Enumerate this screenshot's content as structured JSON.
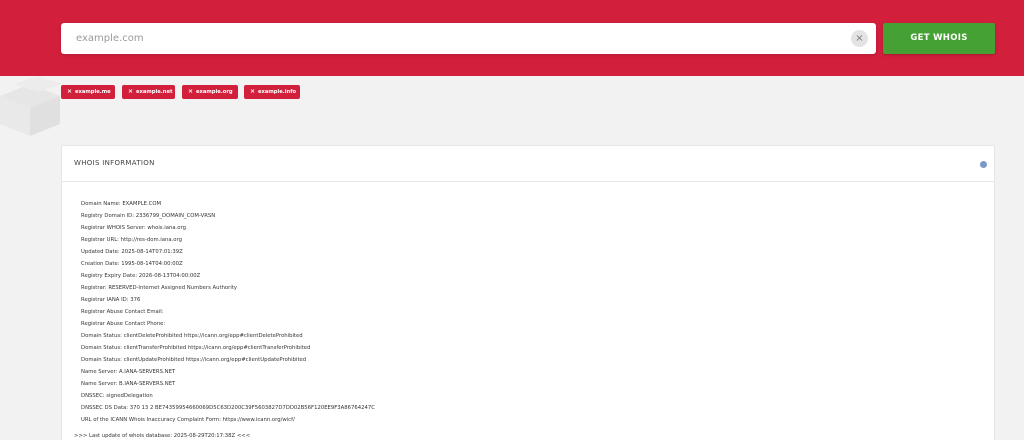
{
  "search": {
    "placeholder": "example.com",
    "clear_icon": "×",
    "button_label": "GET WHOIS"
  },
  "recent_chips": [
    {
      "icon": "×",
      "label": "example.me"
    },
    {
      "icon": "×",
      "label": "example.net"
    },
    {
      "icon": "×",
      "label": "example.org"
    },
    {
      "icon": "×",
      "label": "example.info"
    }
  ],
  "whois": {
    "title": "WHOIS INFORMATION",
    "lines": [
      "Domain Name: EXAMPLE.COM",
      "Registry Domain ID: 2336799_DOMAIN_COM-VRSN",
      "Registrar WHOIS Server: whois.iana.org",
      "Registrar URL: http://res-dom.iana.org",
      "Updated Date: 2025-08-14T07:01:39Z",
      "Creation Date: 1995-08-14T04:00:00Z",
      "Registry Expiry Date: 2026-08-13T04:00:00Z",
      "Registrar: RESERVED-Internet Assigned Numbers Authority",
      "Registrar IANA ID: 376",
      "Registrar Abuse Contact Email:",
      "Registrar Abuse Contact Phone:",
      "Domain Status: clientDeleteProhibited https://icann.org/epp#clientDeleteProhibited",
      "Domain Status: clientTransferProhibited https://icann.org/epp#clientTransferProhibited",
      "Domain Status: clientUpdateProhibited https://icann.org/epp#clientUpdateProhibited",
      "Name Server: A.IANA-SERVERS.NET",
      "Name Server: B.IANA-SERVERS.NET",
      "DNSSEC: signedDelegation",
      "DNSSEC DS Data: 370 13 2 BE74359954660069D5C63D200C39F5603827D7DD02B56F120EE9F3A86764247C",
      "URL of the ICANN Whois Inaccuracy Complaint Form: https://www.icann.org/wicf/"
    ],
    "last_update": ">>> Last update of whois database: 2025-08-29T20:17:38Z <<<"
  },
  "colors": {
    "brand_red": "#d21f3c",
    "button_green": "#46a135",
    "info_icon": "#7b98c9"
  },
  "icons": {
    "clear": "close-icon",
    "chip_remove": "close-icon",
    "info": "info-icon"
  }
}
